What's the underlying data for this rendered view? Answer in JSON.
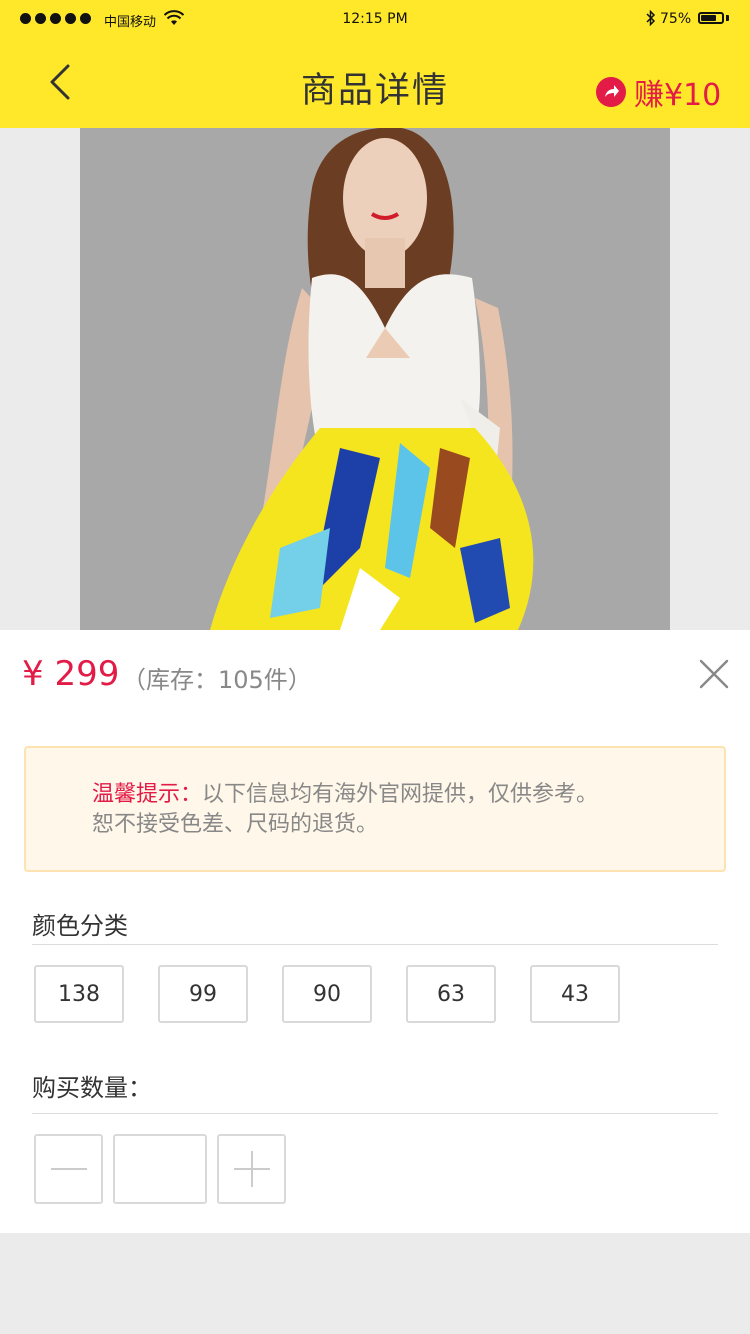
{
  "status_bar": {
    "carrier": "中国移动",
    "time": "12:15 PM",
    "battery_percent": "75%",
    "battery_level": 0.75,
    "signal_dots": 5
  },
  "nav": {
    "back_icon": "chevron-left-icon",
    "title": "商品详情",
    "earn_icon": "share-arrow-icon",
    "earn_label": "赚¥10"
  },
  "product": {
    "image_desc": "product-photo-dress"
  },
  "price_block": {
    "price": "¥ 299",
    "stock": "（库存：105件）",
    "close_icon": "close-icon"
  },
  "notice": {
    "title": "温馨提示：",
    "text_line1": "以下信息均有海外官网提供，仅供参考。",
    "text_line2": "恕不接受色差、尺码的退货。"
  },
  "color_section": {
    "label": "颜色分类",
    "options": [
      "138",
      "99",
      "90",
      "63",
      "43"
    ]
  },
  "quantity_section": {
    "label": "购买数量：",
    "value": "",
    "minus_icon": "minus-icon",
    "plus_icon": "plus-icon"
  },
  "colors": {
    "header_bg": "#ffe82a",
    "accent_red": "#e31b47",
    "notice_bg": "#fff8ea",
    "notice_border": "#fde3b1"
  }
}
